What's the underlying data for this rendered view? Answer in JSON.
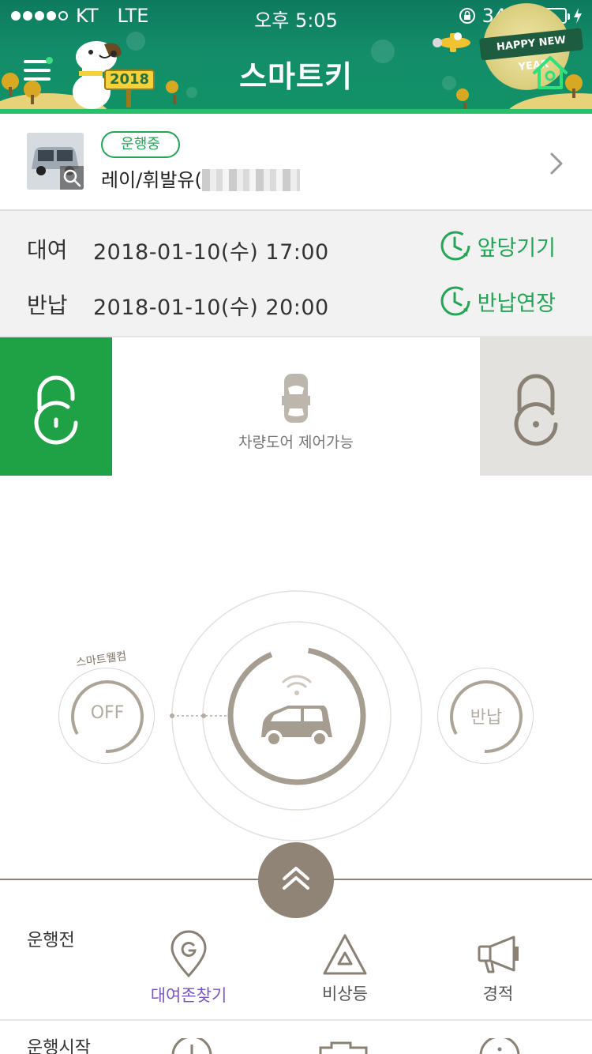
{
  "status_bar": {
    "carrier": "KT",
    "network": "LTE",
    "time": "오후 5:05",
    "battery": "34%",
    "battery_level": 0.34
  },
  "header": {
    "title": "스마트키",
    "sign_text": "2018",
    "banner_text": "HAPPY NEW YEAR",
    "menu_icon": "hamburger-menu-icon",
    "home_icon": "home-icon"
  },
  "vehicle": {
    "status_badge": "운행중",
    "name": "레이/휘발유("
  },
  "rental": {
    "rows": [
      {
        "label": "대여",
        "datetime": "2018-01-10(수) 17:00",
        "action": "앞당기기"
      },
      {
        "label": "반납",
        "datetime": "2018-01-10(수) 20:00",
        "action": "반납연장"
      }
    ]
  },
  "door": {
    "status_text": "차량도어 제어가능"
  },
  "controls": {
    "welcome_caption": "스마트웰컴",
    "welcome_state": "OFF",
    "return_label": "반납"
  },
  "bottom_sheet": {
    "sections": [
      {
        "label": "운행전",
        "items": [
          {
            "label": "대여존찾기",
            "icon": "map-pin-g-icon",
            "active": true
          },
          {
            "label": "비상등",
            "icon": "hazard-triangle-icon",
            "active": false
          },
          {
            "label": "경적",
            "icon": "megaphone-icon",
            "active": false
          }
        ]
      },
      {
        "label": "운행시작",
        "items": []
      }
    ]
  },
  "colors": {
    "brand_green": "#1fa146",
    "accent_green": "#22a555",
    "header_teal": "#138d69",
    "warm_gray": "#8f8475",
    "active_purple": "#7a56c8"
  }
}
